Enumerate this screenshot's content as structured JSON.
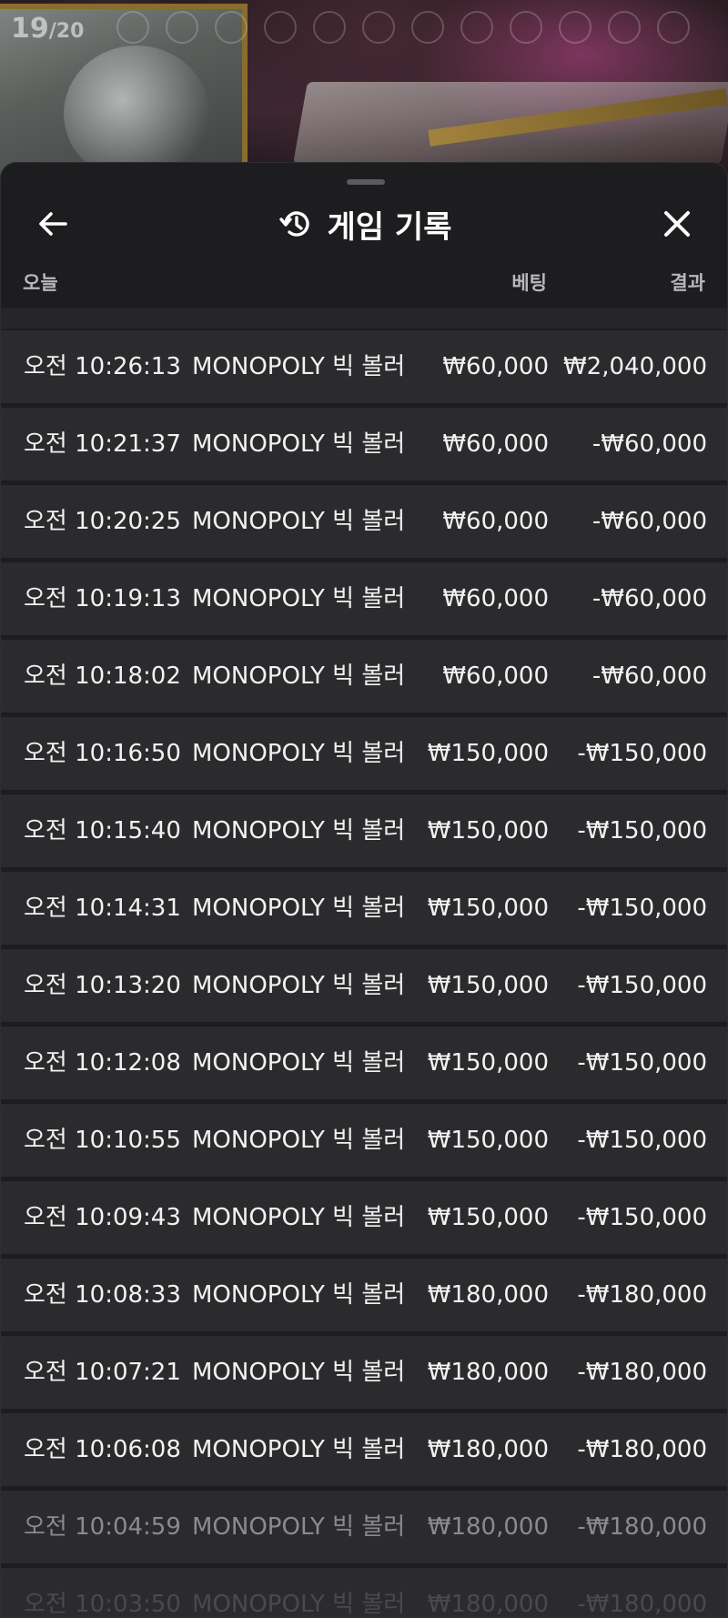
{
  "round": {
    "current": "19",
    "total": "/20"
  },
  "header": {
    "title": "게임 기록"
  },
  "columns": {
    "date": "오늘",
    "bet": "베팅",
    "result": "결과"
  },
  "rows": [
    {
      "time": "오전 10:26:13",
      "game": "MONOPOLY 빅 볼러",
      "bet": "₩60,000",
      "result": "₩2,040,000"
    },
    {
      "time": "오전 10:21:37",
      "game": "MONOPOLY 빅 볼러",
      "bet": "₩60,000",
      "result": "-₩60,000"
    },
    {
      "time": "오전 10:20:25",
      "game": "MONOPOLY 빅 볼러",
      "bet": "₩60,000",
      "result": "-₩60,000"
    },
    {
      "time": "오전 10:19:13",
      "game": "MONOPOLY 빅 볼러",
      "bet": "₩60,000",
      "result": "-₩60,000"
    },
    {
      "time": "오전 10:18:02",
      "game": "MONOPOLY 빅 볼러",
      "bet": "₩60,000",
      "result": "-₩60,000"
    },
    {
      "time": "오전 10:16:50",
      "game": "MONOPOLY 빅 볼러",
      "bet": "₩150,000",
      "result": "-₩150,000"
    },
    {
      "time": "오전 10:15:40",
      "game": "MONOPOLY 빅 볼러",
      "bet": "₩150,000",
      "result": "-₩150,000"
    },
    {
      "time": "오전 10:14:31",
      "game": "MONOPOLY 빅 볼러",
      "bet": "₩150,000",
      "result": "-₩150,000"
    },
    {
      "time": "오전 10:13:20",
      "game": "MONOPOLY 빅 볼러",
      "bet": "₩150,000",
      "result": "-₩150,000"
    },
    {
      "time": "오전 10:12:08",
      "game": "MONOPOLY 빅 볼러",
      "bet": "₩150,000",
      "result": "-₩150,000"
    },
    {
      "time": "오전 10:10:55",
      "game": "MONOPOLY 빅 볼러",
      "bet": "₩150,000",
      "result": "-₩150,000"
    },
    {
      "time": "오전 10:09:43",
      "game": "MONOPOLY 빅 볼러",
      "bet": "₩150,000",
      "result": "-₩150,000"
    },
    {
      "time": "오전 10:08:33",
      "game": "MONOPOLY 빅 볼러",
      "bet": "₩180,000",
      "result": "-₩180,000"
    },
    {
      "time": "오전 10:07:21",
      "game": "MONOPOLY 빅 볼러",
      "bet": "₩180,000",
      "result": "-₩180,000"
    },
    {
      "time": "오전 10:06:08",
      "game": "MONOPOLY 빅 볼러",
      "bet": "₩180,000",
      "result": "-₩180,000"
    },
    {
      "time": "오전 10:04:59",
      "game": "MONOPOLY 빅 볼러",
      "bet": "₩180,000",
      "result": "-₩180,000"
    },
    {
      "time": "오전 10:03:50",
      "game": "MONOPOLY 빅 볼러",
      "bet": "₩180,000",
      "result": "-₩180,000"
    }
  ],
  "icons": {
    "back": "arrow-left-icon",
    "history": "history-icon",
    "close": "close-icon"
  }
}
